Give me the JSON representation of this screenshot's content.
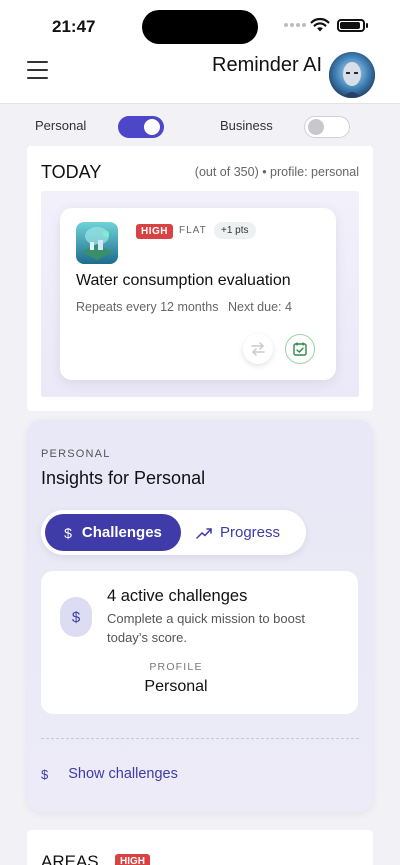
{
  "status_bar": {
    "time": "21:47"
  },
  "header": {
    "title": "Reminder AI",
    "menu_icon": "hamburger-menu-icon",
    "avatar_icon": "avatar-icon"
  },
  "profile_toggle": {
    "personal": {
      "label": "Personal",
      "on": true
    },
    "business": {
      "label": "Business",
      "on": false
    },
    "accent": "#4b47c8"
  },
  "today": {
    "title": "TODAY",
    "meta": "(out of 350) • profile: personal",
    "task": {
      "priority": "HIGH",
      "type": "FLAT",
      "points": "+1 pts",
      "title": "Water consumption evaluation",
      "repeat": "Repeats every 12 months",
      "next_due": "Next due: 4",
      "priority_color": "#d94242"
    }
  },
  "insights": {
    "kicker": "PERSONAL",
    "title": "Insights for Personal",
    "tabs": [
      {
        "label": "Challenges",
        "icon": "dollar-icon",
        "active": true
      },
      {
        "label": "Progress",
        "icon": "trend-chart-icon",
        "active": false
      }
    ],
    "challenge": {
      "title": "4 active challenges",
      "description": "Complete a quick mission to boost today’s score.",
      "profile_label": "PROFILE",
      "profile_value": "Personal"
    },
    "show_link": "Show challenges"
  },
  "areas": {
    "title": "AREAS",
    "badge": "HIGH"
  }
}
